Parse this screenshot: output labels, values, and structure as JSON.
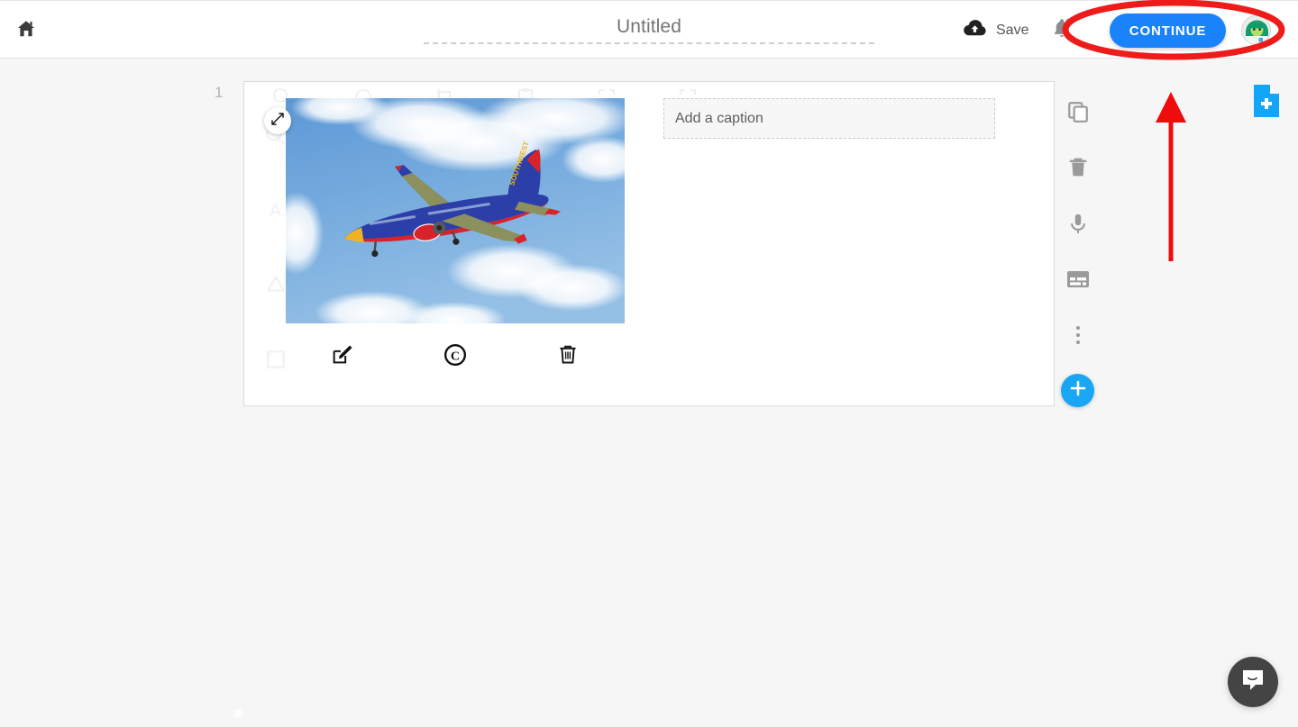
{
  "app": {
    "background_color": "#f6f6f6",
    "accent_color": "#1a82fb",
    "fab_color": "#18a6f5",
    "annotation_color": "#ee1b1b"
  },
  "header": {
    "home_icon": "home-icon",
    "doc_title": "Untitled",
    "save_label": "Save",
    "save_icon": "cloud-upload-icon",
    "bell_icon": "bell-notification-icon",
    "continue_label": "CONTINUE",
    "avatar_icon": "user-avatar"
  },
  "slide": {
    "number": "1",
    "expand_icon": "expand-resize-icon",
    "image_alt": "southwest-airlines-boeing-737-in-flight",
    "caption_placeholder": "Add a caption",
    "image_tools": [
      {
        "name": "edit-image-button",
        "icon": "pencil-square-icon"
      },
      {
        "name": "copyright-button",
        "icon": "copyright-icon"
      },
      {
        "name": "delete-image-button",
        "icon": "trash-icon"
      }
    ],
    "ghost_toolbar_row": [
      "magnifier-icon",
      "circle-icon",
      "crop-icon",
      "clipboard-icon",
      "corners-icon",
      "frame-icon"
    ],
    "ghost_toolbar_col": [
      "magnifier-icon",
      "text-icon",
      "shape-icon",
      "square-icon"
    ]
  },
  "rail": {
    "items": [
      {
        "name": "duplicate-slide-button",
        "icon": "copy-icon"
      },
      {
        "name": "delete-slide-button",
        "icon": "trash-icon"
      },
      {
        "name": "record-audio-button",
        "icon": "microphone-icon"
      },
      {
        "name": "slide-notes-button",
        "icon": "subtitle-card-icon"
      },
      {
        "name": "more-options-button",
        "icon": "vertical-dots-icon"
      }
    ],
    "add_label": "+",
    "add_icon": "plus-icon"
  },
  "add_page": {
    "icon": "add-page-document-icon"
  },
  "annotations": [
    {
      "name": "highlight-ellipse",
      "shape": "ellipse",
      "color": "#ee1b1b",
      "target": "continue-button"
    },
    {
      "name": "pointer-arrow",
      "shape": "arrow-up",
      "color": "#ee1b1b",
      "direction": "up"
    }
  ],
  "chat": {
    "launcher_icon": "chat-bubble-icon"
  }
}
